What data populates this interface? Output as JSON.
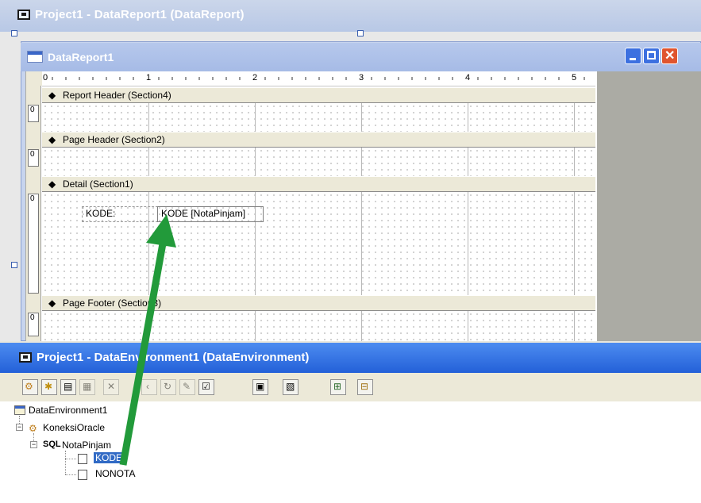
{
  "outer_window": {
    "title": "Project1 - DataReport1 (DataReport)"
  },
  "report_window": {
    "title": "DataReport1",
    "ruler_numbers": [
      "0",
      "1",
      "2",
      "3",
      "4",
      "5"
    ],
    "sections": [
      {
        "label": "Report Header (Section4)",
        "ruler": "0"
      },
      {
        "label": "Page Header (Section2)",
        "ruler": "0"
      },
      {
        "label": "Detail (Section1)",
        "ruler": "0"
      },
      {
        "label": "Page Footer (Section3)",
        "ruler": "0"
      }
    ],
    "detail_fields": {
      "label_text": "KODE:",
      "textbox_text": "KODE [NotaPinjam]"
    }
  },
  "de_window": {
    "title": "Project1 - DataEnvironment1 (DataEnvironment)",
    "tree": {
      "root": "DataEnvironment1",
      "connection": "KoneksiOracle",
      "command": "NotaPinjam",
      "fields": [
        "KODE",
        "NONOTA"
      ]
    }
  },
  "colors": {
    "arrow": "#229a3a",
    "selection": "#316ac5",
    "de_title": "#2360d8",
    "report_title": "#a6bbe6"
  },
  "annotation": {
    "arrow_direction": "from KODE field up to report detail section"
  }
}
